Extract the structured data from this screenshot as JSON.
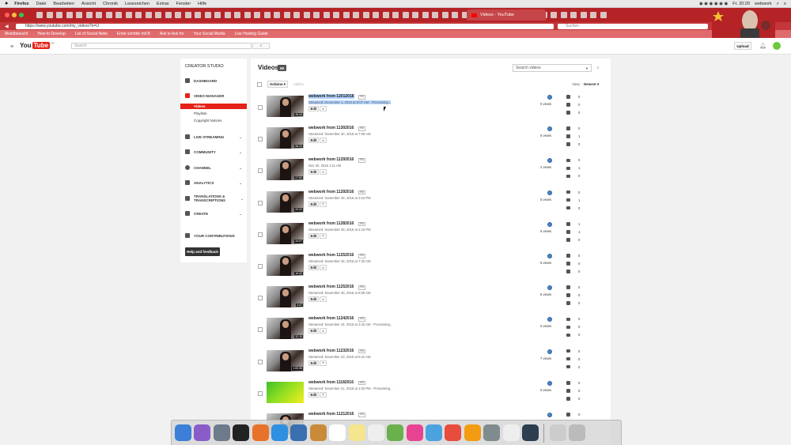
{
  "menubar": {
    "apple": "",
    "app": "Firefox",
    "items": [
      "Datei",
      "Bearbeiten",
      "Ansicht",
      "Chronik",
      "Lesezeichen",
      "Extras",
      "Fenster",
      "Hilfe"
    ],
    "clock": "Fr. 20:20",
    "user": "webwork"
  },
  "browser": {
    "active_tab": "Videos - YouTube",
    "url": "https://www.youtube.com/my_videos?o=U",
    "search_placeholder": "Suchen",
    "bookmarks": [
      "Meistbesucht",
      "How to Develop",
      "List of Social Netw",
      "Erste schritte mit B",
      "Ask to Ask for",
      "Your Social Media",
      "Live Hosting Guide"
    ]
  },
  "youtube": {
    "logo_you": "You",
    "logo_tube": "Tube",
    "logo_country": "DE",
    "search_placeholder": "Search",
    "upload": "Upload"
  },
  "sidebar": {
    "heading": "CREATOR STUDIO",
    "dashboard": "DASHBOARD",
    "video_manager": "VIDEO MANAGER",
    "sub_items": [
      "Videos",
      "Playlists",
      "Copyright Notices"
    ],
    "live_streaming": "LIVE STREAMING",
    "community": "COMMUNITY",
    "channel": "CHANNEL",
    "analytics": "ANALYTICS",
    "translations": "TRANSLATIONS & TRANSCRIPTIONS",
    "create": "CREATE",
    "contributions": "YOUR CONTRIBUTIONS",
    "help": "Help and feedback"
  },
  "main": {
    "title": "Videos",
    "count": "69",
    "search_placeholder": "Search videos",
    "actions": "Actions",
    "add_to": "Add to",
    "view_label": "View:",
    "view_value": "Newest",
    "edit_label": "Edit",
    "hd_label": "HD",
    "videos": [
      {
        "title": "webwork from 12012016",
        "meta": "Streamed: December 1, 2016 at 9:07 AM · Processing...",
        "duration": "45:44",
        "views": "0 views",
        "comments": "0",
        "likes": "0",
        "dislikes": "0",
        "selected": true
      },
      {
        "title": "webwork from 11302016",
        "meta": "Streamed: November 30, 2016 at 7:09 AM",
        "duration": "58:24",
        "views": "6 views",
        "comments": "0",
        "likes": "1",
        "dislikes": "0"
      },
      {
        "title": "webwork from 11292016",
        "meta": "Nov 30, 2016 1:11 AM",
        "duration": "27:50",
        "views": "2 views",
        "comments": "0",
        "likes": "1",
        "dislikes": "0"
      },
      {
        "title": "webwork from 11292016",
        "meta": "Streamed: November 29, 2016 at 3:10 PM",
        "duration": "20:21",
        "views": "5 views",
        "comments": "0",
        "likes": "1",
        "dislikes": "0"
      },
      {
        "title": "webwork from 11282016",
        "meta": "Streamed: November 28, 2016 at 2:15 PM",
        "duration": "34:07",
        "views": "5 views",
        "comments": "1",
        "likes": "1",
        "dislikes": "0"
      },
      {
        "title": "webwork from 11252016",
        "meta": "Streamed: November 25, 2016 at 7:20 AM",
        "duration": "16:42",
        "views": "9 views",
        "comments": "0",
        "likes": "0",
        "dislikes": "0"
      },
      {
        "title": "webwork from 11252016",
        "meta": "Streamed: November 25, 2016 at 6:08 AM",
        "duration": "3:47",
        "views": "6 views",
        "comments": "0",
        "likes": "0",
        "dislikes": "0"
      },
      {
        "title": "webwork from 11242016",
        "meta": "Streamed: November 24, 2016 at 3:42 AM · Processing...",
        "duration": "32:10",
        "views": "0 views",
        "comments": "0",
        "likes": "0",
        "dislikes": "0"
      },
      {
        "title": "webwork from 11232016",
        "meta": "Streamed: November 23, 2016 at 5:31 AM",
        "duration": "1:00:38",
        "views": "7 views",
        "comments": "0",
        "likes": "0",
        "dislikes": "0"
      },
      {
        "title": "webwork from 11182016",
        "meta": "Streamed: November 21, 2016 at 1:03 PM · Processing...",
        "duration": "",
        "views": "0 views",
        "comments": "0",
        "likes": "0",
        "dislikes": "0",
        "green": true
      },
      {
        "title": "webwork from 11212016",
        "meta": "",
        "duration": "",
        "views": "",
        "comments": "0",
        "likes": "",
        "dislikes": ""
      }
    ]
  },
  "colors": {
    "browser_red": "#b52326",
    "yt_red": "#e62117",
    "selection": "#b3d4fc"
  }
}
